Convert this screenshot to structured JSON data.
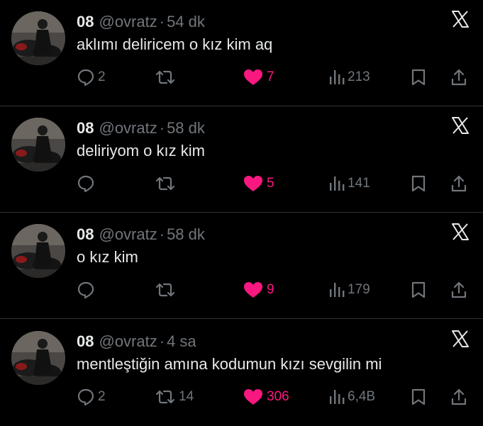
{
  "colors": {
    "background": "#000000",
    "text": "#e7e9ea",
    "muted": "#71767b",
    "like": "#f91880",
    "divider": "#2f3336"
  },
  "icons": {
    "reply": "speech-bubble",
    "retweet": "retweet-arrows",
    "like": "heart-filled",
    "views": "bar-chart",
    "bookmark": "bookmark",
    "share": "share-up-arrow",
    "close": "x-logo"
  },
  "tweets": [
    {
      "name": "08",
      "handle": "@ovratz",
      "separator": "·",
      "time": "54 dk",
      "text": "aklımı deliricem o kız kim aq",
      "replies": "2",
      "retweets": "",
      "likes": "7",
      "views": "213"
    },
    {
      "name": "08",
      "handle": "@ovratz",
      "separator": "·",
      "time": "58 dk",
      "text": "deliriyom o kız kim",
      "replies": "",
      "retweets": "",
      "likes": "5",
      "views": "141"
    },
    {
      "name": "08",
      "handle": "@ovratz",
      "separator": "·",
      "time": "58 dk",
      "text": "o kız kim",
      "replies": "",
      "retweets": "",
      "likes": "9",
      "views": "179"
    },
    {
      "name": "08",
      "handle": "@ovratz",
      "separator": "·",
      "time": "4 sa",
      "text": "mentleştiğin amına kodumun kızı sevgilin mi",
      "replies": "2",
      "retweets": "14",
      "likes": "306",
      "views": "6,4B"
    }
  ]
}
